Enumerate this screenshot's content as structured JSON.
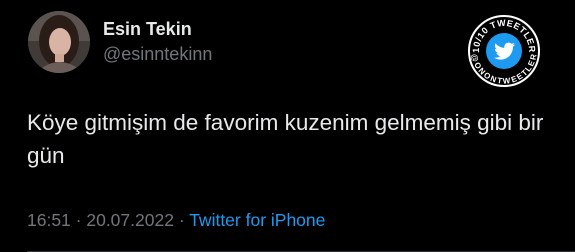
{
  "author": {
    "name": "Esin Tekin",
    "handle": "@esinntekinn"
  },
  "tweet": {
    "text": "Köye gitmişim de favorim kuzenim gelmemiş gibi bir gün"
  },
  "meta": {
    "time": "16:51",
    "sep1": " · ",
    "date": "20.07.2022",
    "sep2": " · ",
    "source": "Twitter for iPhone"
  },
  "badge": {
    "top_text": "10/10 TWEETLER",
    "bottom_text": "@ONONTWEETLER",
    "icon": "twitter-bird-icon"
  },
  "colors": {
    "background": "#000000",
    "text_primary": "#e7e9ea",
    "text_secondary": "#71767b",
    "link": "#1d9bf0"
  }
}
